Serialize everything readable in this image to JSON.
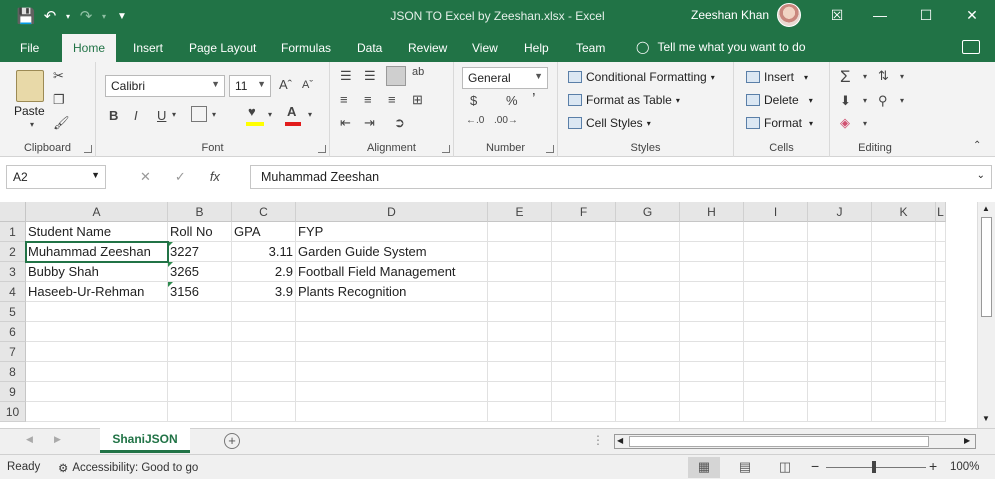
{
  "window": {
    "title": "JSON TO Excel by Zeeshan.xlsx  -  Excel",
    "user": "Zeeshan Khan",
    "controls": [
      "—",
      "☐",
      "✕",
      "☒"
    ]
  },
  "ribbon_tabs": [
    "File",
    "Home",
    "Insert",
    "Page Layout",
    "Formulas",
    "Data",
    "Review",
    "View",
    "Help",
    "Team"
  ],
  "tell_me": "Tell me what you want to do",
  "ribbon": {
    "clipboard": {
      "paste": "Paste",
      "label": "Clipboard"
    },
    "font": {
      "name": "Calibri",
      "size": "11",
      "bold": "B",
      "italic": "I",
      "underline": "U",
      "label": "Font",
      "font_color": "#e21c1c",
      "fill_color": "#ffff00"
    },
    "alignment": {
      "label": "Alignment",
      "wrap": "ab"
    },
    "number": {
      "format": "General",
      "currency": "$",
      "percent": "%",
      "comma": "’",
      "label": "Number"
    },
    "styles": {
      "conditional": "Conditional Formatting",
      "format_table": "Format as Table",
      "cell_styles": "Cell Styles",
      "label": "Styles"
    },
    "cells": {
      "insert": "Insert",
      "delete": "Delete",
      "format": "Format",
      "label": "Cells"
    },
    "editing": {
      "label": "Editing"
    }
  },
  "formula_bar": {
    "name_box": "A2",
    "fx": "fx",
    "value": "Muhammad Zeeshan"
  },
  "grid": {
    "columns": [
      "A",
      "B",
      "C",
      "D",
      "E",
      "F",
      "G",
      "H",
      "I",
      "J",
      "K",
      "L"
    ],
    "rows": [
      "1",
      "2",
      "3",
      "4",
      "5",
      "6",
      "7",
      "8",
      "9",
      "10"
    ],
    "data": [
      [
        "Student Name",
        "Roll No",
        "GPA",
        "FYP"
      ],
      [
        "Muhammad Zeeshan",
        "3227",
        "3.11",
        "Garden Guide System"
      ],
      [
        "Bubby Shah",
        "3265",
        "2.9",
        "Football Field Management"
      ],
      [
        "Haseeb-Ur-Rehman",
        "3156",
        "3.9",
        "Plants Recognition"
      ]
    ]
  },
  "sheet_tabs": [
    "ShaniJSON"
  ],
  "status": {
    "ready": "Ready",
    "accessibility": "Accessibility: Good to go",
    "zoom": "100%"
  },
  "colors": {
    "accent": "#217346",
    "ribbon_bg": "#f3f3f3",
    "header_bg": "#e6e6e6"
  }
}
